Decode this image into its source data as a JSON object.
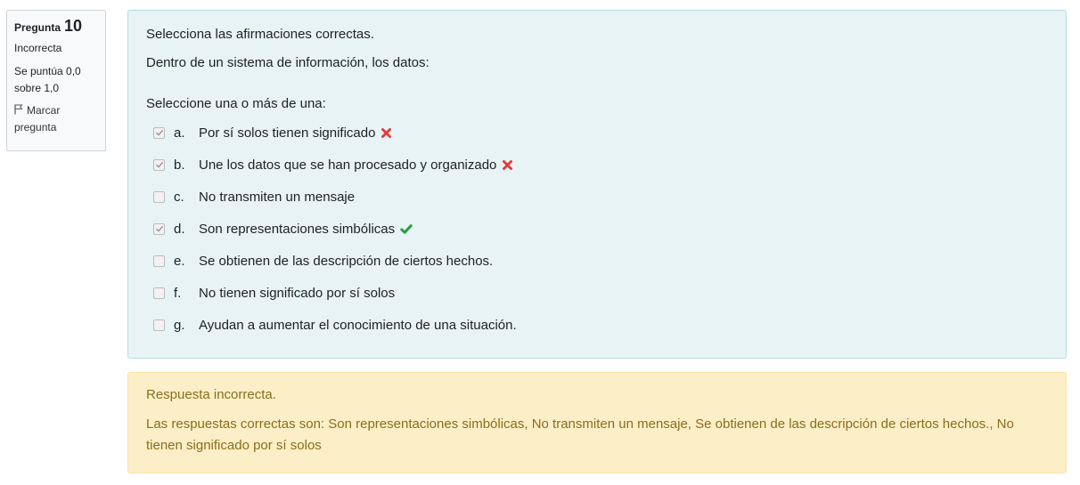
{
  "info": {
    "question_label": "Pregunta",
    "question_number": "10",
    "state": "Incorrecta",
    "grade": "Se puntúa 0,0 sobre 1,0",
    "flag_label": "Marcar pregunta"
  },
  "question": {
    "intro": "Selecciona las afirmaciones correctas.",
    "stem": "Dentro de un sistema de información, los datos:",
    "prompt": "Seleccione una o más de una:",
    "options": [
      {
        "letter": "a.",
        "text": "Por sí solos tienen significado",
        "checked": true,
        "mark": "incorrect"
      },
      {
        "letter": "b.",
        "text": "Une los datos que se han procesado y organizado",
        "checked": true,
        "mark": "incorrect"
      },
      {
        "letter": "c.",
        "text": "No transmiten un mensaje",
        "checked": false,
        "mark": ""
      },
      {
        "letter": "d.",
        "text": "Son representaciones simbólicas",
        "checked": true,
        "mark": "correct"
      },
      {
        "letter": "e.",
        "text": "Se obtienen de las descripción de ciertos hechos.",
        "checked": false,
        "mark": ""
      },
      {
        "letter": "f.",
        "text": "No tienen significado por sí solos",
        "checked": false,
        "mark": ""
      },
      {
        "letter": "g.",
        "text": "Ayudan a aumentar el conocimiento de una situación.",
        "checked": false,
        "mark": ""
      }
    ]
  },
  "feedback": {
    "result": "Respuesta incorrecta.",
    "right_answer": "Las respuestas correctas son: Son representaciones simbólicas, No transmiten un mensaje, Se obtienen de las descripción de ciertos hechos., No tienen significado por sí solos"
  },
  "colors": {
    "incorrect": "#e03e3e",
    "correct": "#2a9d3c"
  }
}
